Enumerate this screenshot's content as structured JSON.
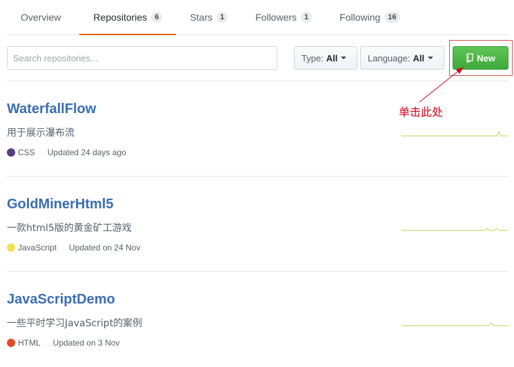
{
  "tabs": [
    {
      "label": "Overview",
      "count": ""
    },
    {
      "label": "Repositories",
      "count": "6"
    },
    {
      "label": "Stars",
      "count": "1"
    },
    {
      "label": "Followers",
      "count": "1"
    },
    {
      "label": "Following",
      "count": "16"
    }
  ],
  "toolbar": {
    "search_placeholder": "Search repositories...",
    "type_label": "Type:",
    "type_value": "All",
    "language_label": "Language:",
    "language_value": "All",
    "new_label": "New"
  },
  "annotation": {
    "text": "单击此处",
    "color": "#d0021b"
  },
  "repos": [
    {
      "name": "WaterfallFlow",
      "description": "用于展示瀑布流",
      "language": "CSS",
      "language_color": "#563d7c",
      "updated": "Updated 24 days ago"
    },
    {
      "name": "GoldMinerHtml5",
      "description": "一款html5版的黄金矿工游戏",
      "language": "JavaScript",
      "language_color": "#f1e05a",
      "updated": "Updated on 24 Nov"
    },
    {
      "name": "JavaScriptDemo",
      "description": "一些平时学习JavaScript的案例",
      "language": "HTML",
      "language_color": "#e34c26",
      "updated": "Updated on 3 Nov"
    }
  ],
  "colors": {
    "accent_tab": "#e36209",
    "repo_link": "#3a6eb3",
    "new_button": "#4cb944",
    "sparkline": "#dce8a6"
  }
}
